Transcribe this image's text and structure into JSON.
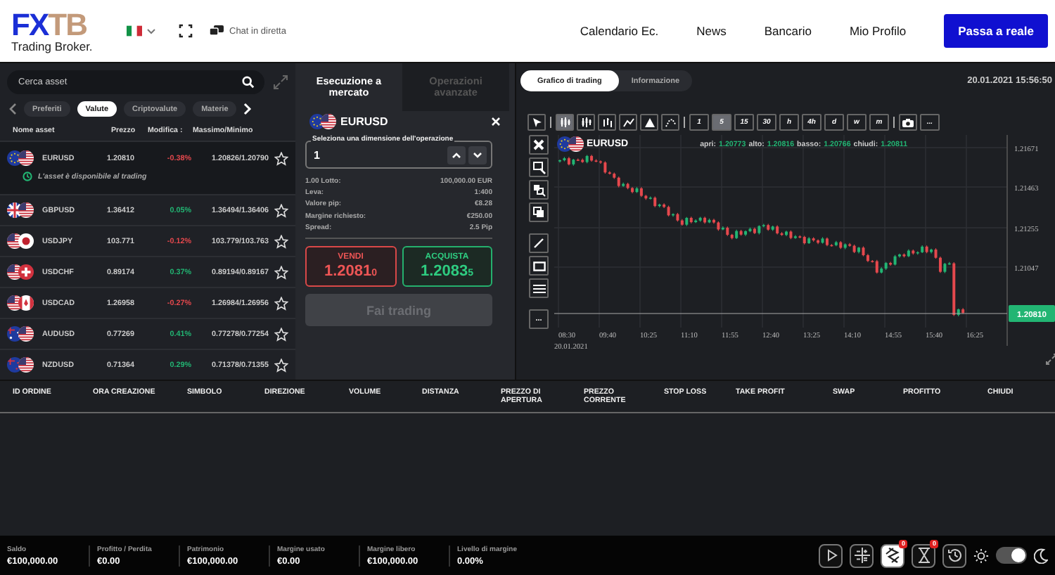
{
  "header": {
    "logo_part_1": "FX",
    "logo_part_2": "TB",
    "tagline": "Trading Broker.",
    "language_flag": {
      "kind": "it"
    },
    "chat_label": "Chat in diretta",
    "nav": [
      {
        "label": "Calendario Ec."
      },
      {
        "label": "News"
      },
      {
        "label": "Bancario"
      },
      {
        "label": "Mio Profilo"
      }
    ],
    "cta": "Passa a reale"
  },
  "assets": {
    "search_placeholder": "Cerca asset",
    "categories": [
      {
        "label": "Preferiti",
        "selected": false
      },
      {
        "label": "Valute",
        "selected": true
      },
      {
        "label": "Criptovalute",
        "selected": false
      },
      {
        "label": "Materie",
        "selected": false
      }
    ],
    "columns": [
      "Nome asset",
      "Prezzo",
      "Modifica :",
      "Massimo/Minimo"
    ],
    "rows": [
      {
        "symbol": "EURUSD",
        "flags": [
          {
            "kind": "eu"
          },
          {
            "kind": "us"
          }
        ],
        "price": "1.20810",
        "change": "-0.38%",
        "color": "#e5484d",
        "range": "1.20826/1.20790",
        "favorite": false,
        "expanded": true,
        "note": "L'asset è disponibile al trading"
      },
      {
        "symbol": "GBPUSD",
        "flags": [
          {
            "kind": "gb"
          },
          {
            "kind": "us"
          }
        ],
        "price": "1.36412",
        "change": "0.05%",
        "color": "#22b573",
        "range": "1.36494/1.36406",
        "favorite": false,
        "expanded": false
      },
      {
        "symbol": "USDJPY",
        "flags": [
          {
            "kind": "us"
          },
          {
            "kind": "jp"
          }
        ],
        "price": "103.771",
        "change": "-0.12%",
        "color": "#e5484d",
        "range": "103.779/103.763",
        "favorite": false,
        "expanded": false
      },
      {
        "symbol": "USDCHF",
        "flags": [
          {
            "kind": "us"
          },
          {
            "kind": "ch"
          }
        ],
        "price": "0.89174",
        "change": "0.37%",
        "color": "#22b573",
        "range": "0.89194/0.89167",
        "favorite": false,
        "expanded": false
      },
      {
        "symbol": "USDCAD",
        "flags": [
          {
            "kind": "us"
          },
          {
            "kind": "ca"
          }
        ],
        "price": "1.26958",
        "change": "-0.27%",
        "color": "#e5484d",
        "range": "1.26984/1.26956",
        "favorite": false,
        "expanded": false
      },
      {
        "symbol": "AUDUSD",
        "flags": [
          {
            "kind": "au"
          },
          {
            "kind": "us"
          }
        ],
        "price": "0.77269",
        "change": "0.41%",
        "color": "#22b573",
        "range": "0.77278/0.77254",
        "favorite": false,
        "expanded": false
      },
      {
        "symbol": "NZDUSD",
        "flags": [
          {
            "kind": "nz"
          },
          {
            "kind": "us"
          }
        ],
        "price": "0.71364",
        "change": "0.29%",
        "color": "#22b573",
        "range": "0.71378/0.71355",
        "favorite": false,
        "expanded": false
      }
    ]
  },
  "order_panel": {
    "tabs": [
      {
        "label": "Esecuzione a mercato",
        "selected": true
      },
      {
        "label": "Operazioni avanzate",
        "selected": false
      }
    ],
    "symbol": "EURUSD",
    "flags": [
      {
        "kind": "eu"
      },
      {
        "kind": "us"
      }
    ],
    "size_label": "Seleziona una dimensione dell'operazione",
    "size_value": "1",
    "details": [
      {
        "label": "1.00 Lotto:",
        "value": "100,000.00 EUR"
      },
      {
        "label": "Leva:",
        "value": "1:400"
      },
      {
        "label": "Valore pip:",
        "value": "€8.28"
      },
      {
        "label": "Margine richiesto:",
        "value": "€250.00"
      },
      {
        "label": "Spread:",
        "value": "2.5 Pip"
      }
    ],
    "sell": {
      "label": "VENDI",
      "price": "1.2081",
      "pip": "0"
    },
    "buy": {
      "label": "ACQUISTA",
      "price": "1.2083",
      "pip": "5"
    },
    "trade_button": {
      "label": "Fai trading",
      "disabled": true
    }
  },
  "chart": {
    "tabs": [
      {
        "label": "Grafico di trading",
        "selected": true
      },
      {
        "label": "Informazione",
        "selected": false
      }
    ],
    "datetime": "20.01.2021 15:56:50",
    "chart_types": [
      {
        "kind": "candles",
        "selected": true
      },
      {
        "kind": "hollow",
        "selected": false
      },
      {
        "kind": "bars",
        "selected": false
      },
      {
        "kind": "line",
        "selected": false
      },
      {
        "kind": "area",
        "selected": false
      },
      {
        "kind": "dots",
        "selected": false
      }
    ],
    "timeframes": [
      {
        "label": "1",
        "selected": false
      },
      {
        "label": "5",
        "selected": true
      },
      {
        "label": "15",
        "selected": false
      },
      {
        "label": "30",
        "selected": false
      },
      {
        "label": "h",
        "selected": false
      },
      {
        "label": "4h",
        "selected": false
      },
      {
        "label": "d",
        "selected": false
      },
      {
        "label": "w",
        "selected": false
      },
      {
        "label": "m",
        "selected": false
      }
    ],
    "more_label": "...",
    "side_more_label": "...",
    "symbol": "EURUSD",
    "flags": [
      {
        "kind": "eu"
      },
      {
        "kind": "us"
      }
    ],
    "ohlc": [
      {
        "label": "apri:",
        "value": "1.20773"
      },
      {
        "label": "alto:",
        "value": "1.20816"
      },
      {
        "label": "basso:",
        "value": "1.20766"
      },
      {
        "label": "chiudi:",
        "value": "1.20811"
      }
    ],
    "y_labels": [
      "1.21671",
      "1.21463",
      "1.21255",
      "1.21047"
    ],
    "current_price": "1.20810",
    "x_labels": [
      "08:30",
      "09:40",
      "10:25",
      "11:10",
      "11:55",
      "12:40",
      "13:25",
      "14:10",
      "14:55",
      "15:40",
      "16:25"
    ],
    "date_label": "20.01.2021"
  },
  "positions": {
    "columns": [
      "ID ORDINE",
      "ORA CREAZIONE",
      "SIMBOLO",
      "DIREZIONE",
      "VOLUME",
      "DISTANZA",
      "PREZZO DI APERTURA",
      "PREZZO CORRENTE",
      "STOP LOSS",
      "TAKE PROFIT",
      "SWAP",
      "PROFITTO",
      "CHIUDI"
    ]
  },
  "account": [
    {
      "label": "Saldo",
      "value": "€100,000.00"
    },
    {
      "label": "Profitto / Perdita",
      "value": "€0.00"
    },
    {
      "label": "Patrimonio",
      "value": "€100,000.00"
    },
    {
      "label": "Margine usato",
      "value": "€0.00"
    },
    {
      "label": "Margine libero",
      "value": "€100,000.00"
    },
    {
      "label": "Livello di margine",
      "value": "0.00%"
    }
  ],
  "tools": [
    {
      "kind": "play",
      "selected": false
    },
    {
      "kind": "calculator",
      "selected": false
    },
    {
      "kind": "signals",
      "selected": true,
      "badge": "0"
    },
    {
      "kind": "pending",
      "selected": false,
      "badge": "0"
    },
    {
      "kind": "history",
      "selected": false
    }
  ],
  "dark_mode": true
}
